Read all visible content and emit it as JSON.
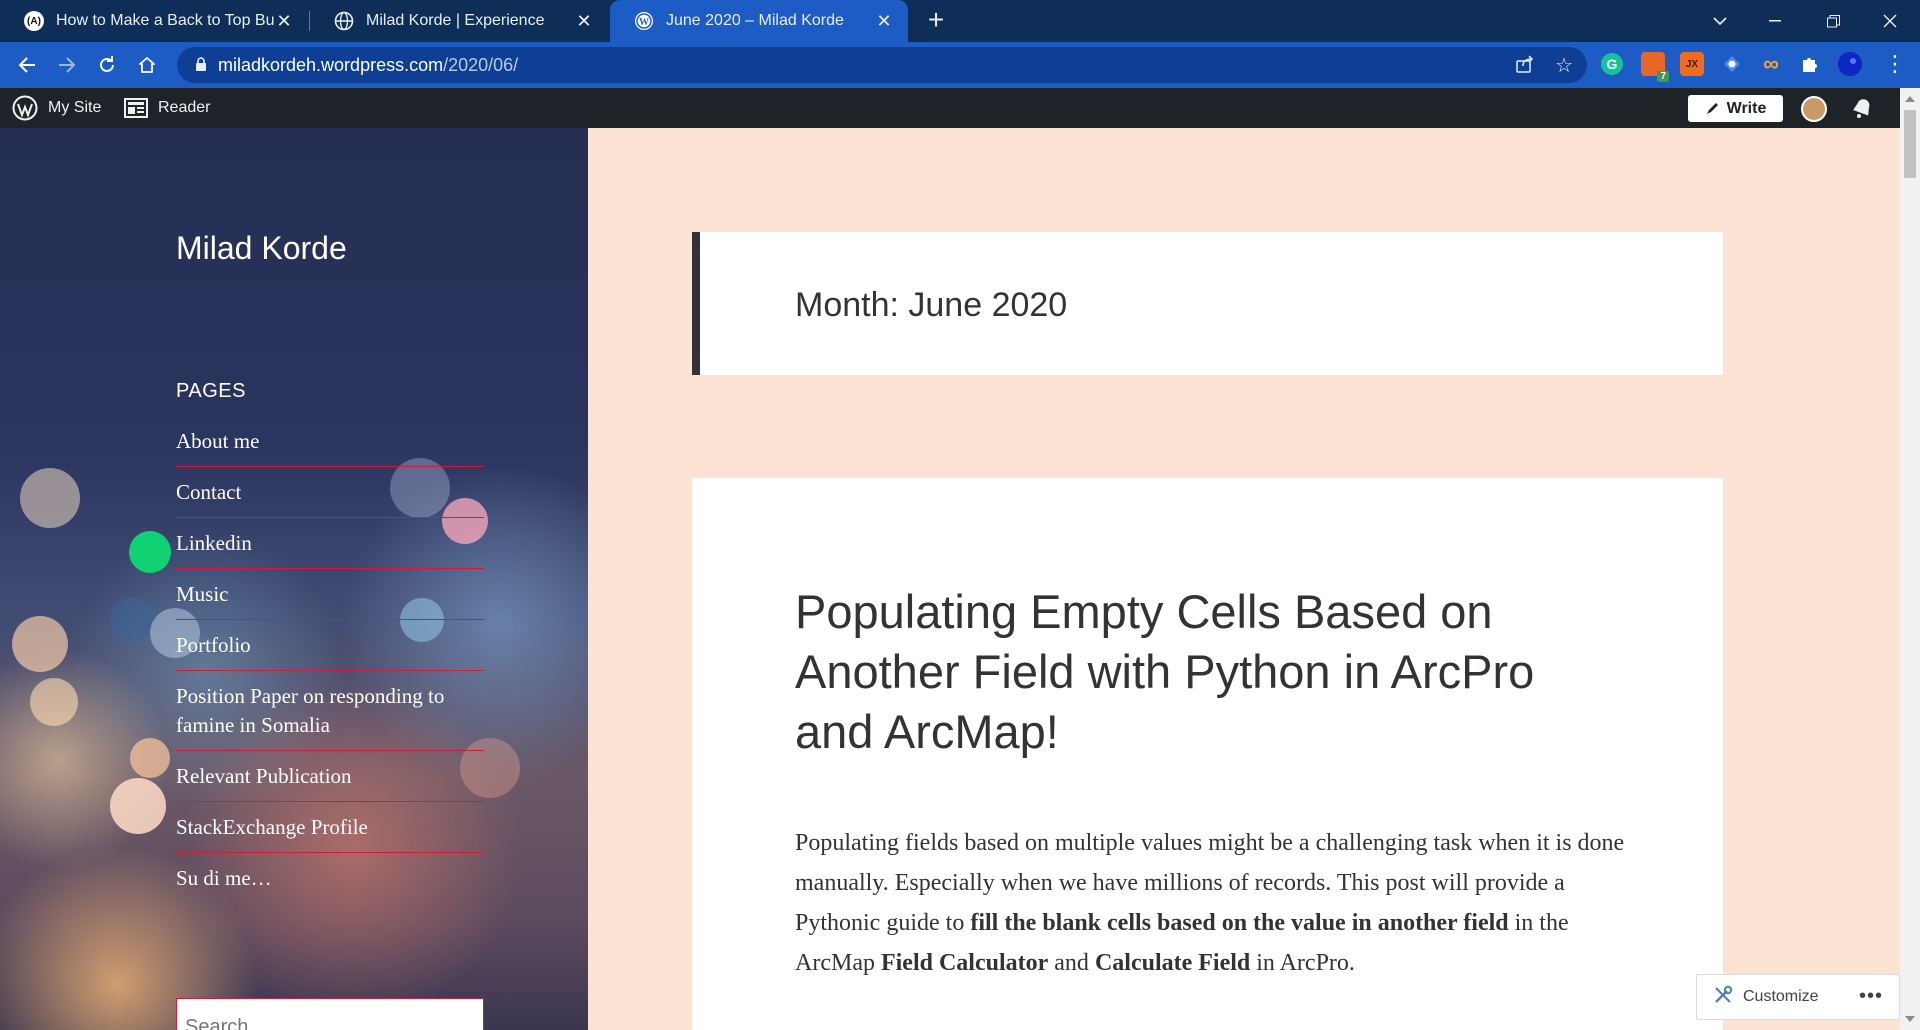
{
  "browser": {
    "tabs": [
      {
        "title": "How to Make a Back to Top Butto",
        "favicon": "(A)",
        "active": false
      },
      {
        "title": "Milad Korde | Experience",
        "favicon": "globe",
        "active": false
      },
      {
        "title": "June 2020 – Milad Korde",
        "favicon": "W",
        "active": true
      }
    ],
    "new_tab": "+",
    "url_host": "miladkordeh.wordpress.com",
    "url_path": "/2020/06/",
    "extensions": [
      {
        "name": "grammarly-icon",
        "label": "G",
        "color": "#15c39a"
      },
      {
        "name": "extension-badge-icon",
        "label": "7",
        "color": "#e8682a"
      },
      {
        "name": "jx-extension-icon",
        "label": "JX",
        "color": "#f26b1d"
      },
      {
        "name": "blue-extension-icon",
        "label": "",
        "color": "#4a8af4"
      },
      {
        "name": "infinity-extension-icon",
        "label": "∞",
        "color": "#f6a623"
      }
    ]
  },
  "adminbar": {
    "my_site": "My Site",
    "reader": "Reader",
    "write": "Write"
  },
  "sidebar": {
    "site_title": "Milad Korde",
    "pages_heading": "PAGES",
    "pages": [
      "About me",
      "Contact",
      "Linkedin",
      "Music",
      "Portfolio",
      "Position Paper on responding to famine in Somalia",
      "Relevant Publication",
      "StackExchange Profile",
      "Su di me…"
    ],
    "search_placeholder": "Search …"
  },
  "main": {
    "archive_title": "Month: June 2020",
    "post_title": "Populating Empty Cells Based on Another Field with Python in ArcPro and ArcMap!",
    "excerpt": {
      "t1": "Populating fields based on multiple values might be a challenging task when it is done manually. Especially when we have millions of records. This post will provide a Pythonic guide to ",
      "b1": "fill the blank cells based on the value in another field",
      "t2": " in the ArcMap ",
      "b2": "Field Calculator",
      "t3": " and ",
      "b3": "Calculate Field",
      "t4": " in ArcPro."
    }
  },
  "customize": {
    "label": "Customize",
    "more": "•••"
  }
}
